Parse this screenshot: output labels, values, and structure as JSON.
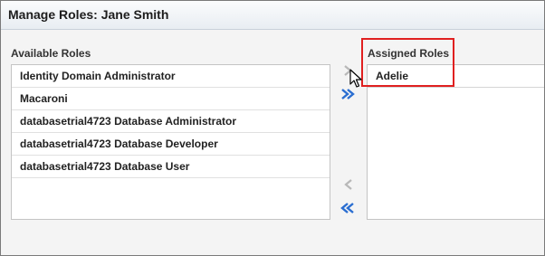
{
  "header": {
    "title": "Manage Roles: Jane Smith"
  },
  "available": {
    "label": "Available Roles",
    "items": [
      "Identity Domain Administrator",
      "Macaroni",
      "databasetrial4723 Database Administrator",
      "databasetrial4723 Database Developer",
      "databasetrial4723 Database User"
    ]
  },
  "assigned": {
    "label": "Assigned Roles",
    "items": [
      "Adelie"
    ]
  },
  "shuttle": {
    "move_icon": "chevron-right-icon",
    "move_all_icon": "double-chevron-right-icon",
    "remove_icon": "chevron-left-icon",
    "remove_all_icon": "double-chevron-left-icon"
  },
  "colors": {
    "accent_blue": "#2a6ed1",
    "disabled_gray": "#b8b8b8",
    "highlight_red": "#e02020"
  }
}
